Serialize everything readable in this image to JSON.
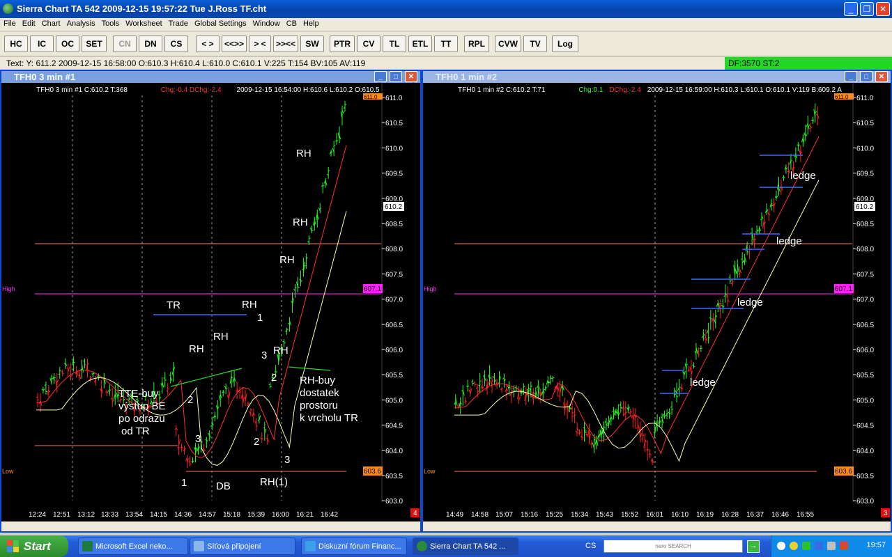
{
  "window": {
    "title": "Sierra Chart TA 542   2009-12-15   19:57:22  Tue    J.Ross TF.cht",
    "minimize": "_",
    "maximize": "❐",
    "close": "✕"
  },
  "menu": [
    "File",
    "Edit",
    "Chart",
    "Analysis",
    "Tools",
    "Worksheet",
    "Trade",
    "Global Settings",
    "Window",
    "CB",
    "Help"
  ],
  "toolbar": [
    "HC",
    "IC",
    "OC",
    "SET",
    "CN",
    "DN",
    "CS",
    "< >",
    "<<>>",
    "> <",
    ">><<",
    "SW",
    "PTR",
    "CV",
    "TL",
    "ETL",
    "TT",
    "RPL",
    "CVW",
    "TV",
    "Log"
  ],
  "status": {
    "text": "Text: Y: 611.2  2009-12-15  16:58:00  O:610.3  H:610.4  L:610.0  C:610.1  V:225  T:154  BV:105  AV:119",
    "df": "DF:3570   ST:2"
  },
  "charts": [
    {
      "title": "TFH0  3 min  #1",
      "info": [
        {
          "t": "TFH0  3 min   #1  C:610.2  T:368",
          "c": "#ffffff"
        },
        {
          "t": "Chg:-0.4  DChg:-2.4",
          "c": "#ff3030"
        },
        {
          "t": "2009-12-15  16:54:00  H:610.6  L:610.2  O:610.5",
          "c": "#ffffff"
        }
      ],
      "yticks": [
        "611.0",
        "610.5",
        "610.0",
        "609.5",
        "609.0",
        "608.5",
        "608.0",
        "607.5",
        "607.0",
        "606.5",
        "606.0",
        "605.5",
        "605.0",
        "604.5",
        "604.0",
        "603.5",
        "603.0"
      ],
      "xticks": [
        "12:24",
        "12:51",
        "13:12",
        "13:33",
        "13:54",
        "14:15",
        "14:36",
        "14:57",
        "15:18",
        "15:39",
        "16:00",
        "16:21",
        "16:42"
      ],
      "price_tag": "610.2",
      "high_tag": "607.1",
      "low_tag": "603.6",
      "top_tag": "611.0",
      "high_label": "High",
      "low_label": "Low",
      "corner_badge": "4",
      "annotations": [
        {
          "text": "RH"
        },
        {
          "text": "RH"
        },
        {
          "text": "RH"
        },
        {
          "text": "TR"
        },
        {
          "text": "RH"
        },
        {
          "text": "1"
        },
        {
          "text": "RH"
        },
        {
          "text": "RH"
        },
        {
          "text": "3"
        },
        {
          "text": "RH"
        },
        {
          "text": "2"
        },
        {
          "text": "TTE-buy"
        },
        {
          "text": "výstup BE"
        },
        {
          "text": "po odrazu"
        },
        {
          "text": "od TR"
        },
        {
          "text": "RH-buy"
        },
        {
          "text": "dostatek"
        },
        {
          "text": "prostoru"
        },
        {
          "text": "k vrcholu TR"
        },
        {
          "text": "2"
        },
        {
          "text": "3"
        },
        {
          "text": "2"
        },
        {
          "text": "3"
        },
        {
          "text": "1"
        },
        {
          "text": "DB"
        },
        {
          "text": "RH(1)"
        }
      ]
    },
    {
      "title": "TFH0  1 min  #2",
      "info": [
        {
          "t": "TFH0  1 min   #2  C:610.2  T:71",
          "c": "#ffffff"
        },
        {
          "t": "Chg:0.1",
          "c": "#30ff30"
        },
        {
          "t": "DChg:-2.4",
          "c": "#ff3030"
        },
        {
          "t": "2009-12-15  16:59:00  H:610.3  L:610.1  O:610.1  V:119  B:609.2  A",
          "c": "#ffffff"
        }
      ],
      "yticks": [
        "611.0",
        "610.5",
        "610.0",
        "609.5",
        "609.0",
        "608.5",
        "608.0",
        "607.5",
        "607.0",
        "606.5",
        "606.0",
        "605.5",
        "605.0",
        "604.5",
        "604.0",
        "603.5",
        "603.0"
      ],
      "xticks": [
        "14:49",
        "14:58",
        "15:07",
        "15:16",
        "15:25",
        "15:34",
        "15:43",
        "15:52",
        "16:01",
        "16:10",
        "16:19",
        "16:28",
        "16:37",
        "16:46",
        "16:55"
      ],
      "price_tag": "610.2",
      "high_tag": "607.1",
      "low_tag": "603.6",
      "top_tag": "611.0",
      "high_label": "High",
      "low_label": "Low",
      "corner_badge": "3",
      "annotations": [
        {
          "text": "ledge"
        },
        {
          "text": "ledge"
        },
        {
          "text": "ledge"
        },
        {
          "text": "ledge"
        }
      ]
    }
  ],
  "taskbar": {
    "start": "Start",
    "tasks": [
      "Microsoft Excel neko...",
      "Síťová připojení",
      "Diskuzní fórum Financ...",
      "Sierra Chart TA 542  ..."
    ],
    "lang": "CS",
    "search": "nero SEARCH",
    "clock": "19:57"
  }
}
